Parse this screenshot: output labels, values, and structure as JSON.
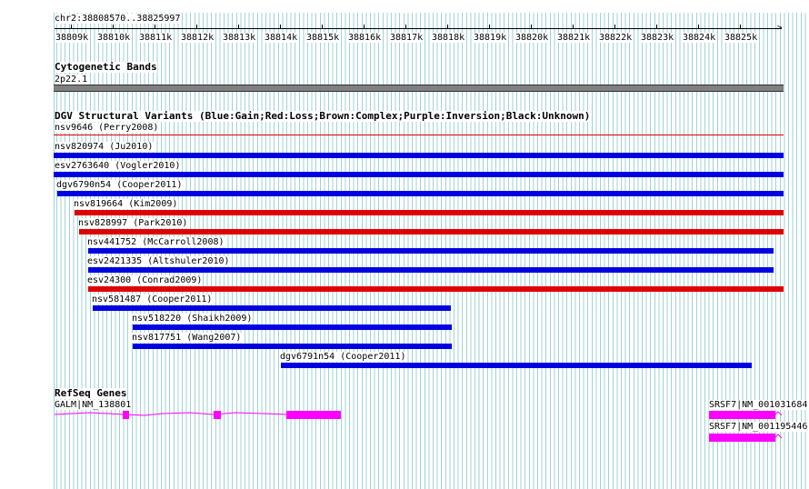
{
  "ruler": {
    "coords": "chr2:38808570..38825997",
    "ticks": [
      "38809k",
      "38810k",
      "38811k",
      "38812k",
      "38813k",
      "38814k",
      "38815k",
      "38816k",
      "38817k",
      "38818k",
      "38819k",
      "38820k",
      "38821k",
      "38822k",
      "38823k",
      "38824k",
      "38825k"
    ]
  },
  "cytoband": {
    "title": "Cytogenetic Bands",
    "band_label": "2p22.1"
  },
  "dgv": {
    "title": "DGV Structural Variants (Blue:Gain;Red:Loss;Brown:Complex;Purple:Inversion;Black:Unknown)",
    "colors": {
      "gain": "#0000e0",
      "loss": "#e00000",
      "loss_thin": "#e00000"
    },
    "variants": [
      {
        "label": "nsv9646 (Perry2008)",
        "type": "loss_thin"
      },
      {
        "label": "nsv820974 (Ju2010)",
        "type": "gain"
      },
      {
        "label": "esv2763640 (Vogler2010)",
        "type": "gain"
      },
      {
        "label": "dgv6790n54 (Cooper2011)",
        "type": "gain"
      },
      {
        "label": "nsv819664 (Kim2009)",
        "type": "loss"
      },
      {
        "label": "nsv828997 (Park2010)",
        "type": "loss"
      },
      {
        "label": "nsv441752 (McCarroll2008)",
        "type": "gain"
      },
      {
        "label": "esv2421335 (Altshuler2010)",
        "type": "gain"
      },
      {
        "label": "esv24300 (Conrad2009)",
        "type": "loss"
      },
      {
        "label": "nsv581487 (Cooper2011)",
        "type": "gain"
      },
      {
        "label": "nsv518220 (Shaikh2009)",
        "type": "gain"
      },
      {
        "label": "nsv817751 (Wang2007)",
        "type": "gain"
      },
      {
        "label": "dgv6791n54 (Cooper2011)",
        "type": "gain"
      }
    ]
  },
  "refseq": {
    "title": "RefSeq Genes",
    "color": "#ff00ff",
    "genes": [
      {
        "label": "GALM|NM_138801"
      },
      {
        "label": "SRSF7|NM_001031684"
      },
      {
        "label": "SRSF7|NM_001195446"
      }
    ]
  }
}
